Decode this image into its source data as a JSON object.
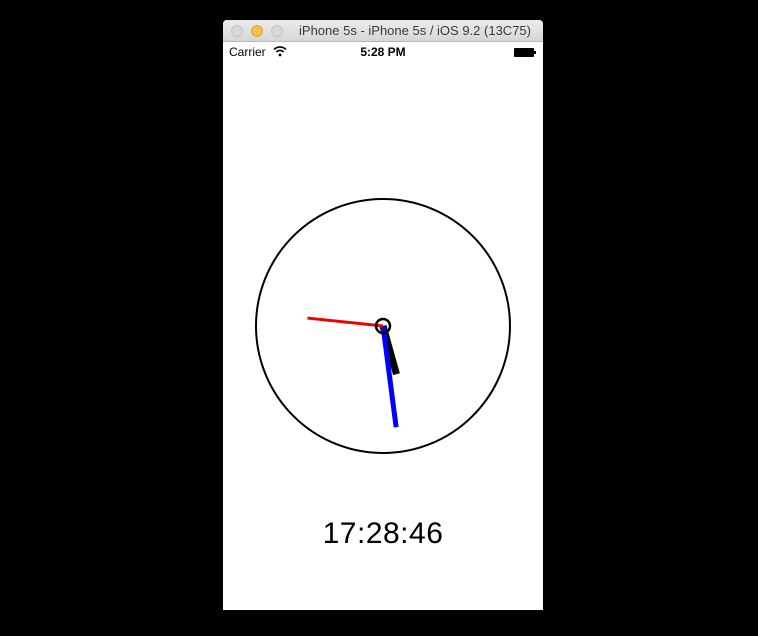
{
  "window": {
    "title": "iPhone 5s - iPhone 5s / iOS 9.2 (13C75)"
  },
  "status_bar": {
    "carrier": "Carrier",
    "time": "5:28 PM",
    "wifi_icon": "wifi-icon",
    "battery_icon": "battery-icon"
  },
  "clock": {
    "digital_time": "17:28:46",
    "hours": 17,
    "minutes": 28,
    "seconds": 46,
    "hand_colors": {
      "hour": "#000000",
      "minute": "#0000ff",
      "second": "#ee0000"
    },
    "face_color": "#000000"
  }
}
